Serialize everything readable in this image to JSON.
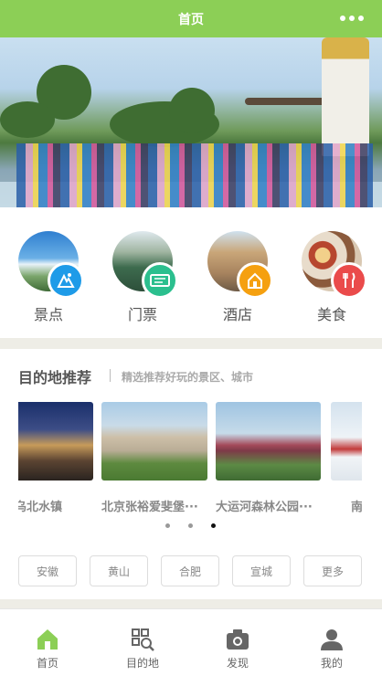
{
  "header": {
    "title": "首页",
    "more_icon": "more-dots-icon"
  },
  "categories": [
    {
      "label": "景点",
      "icon": "scenic-spot-icon",
      "badge_color": "#1e9be8"
    },
    {
      "label": "门票",
      "icon": "ticket-icon",
      "badge_color": "#2bbf8e"
    },
    {
      "label": "酒店",
      "icon": "hotel-icon",
      "badge_color": "#f5a010"
    },
    {
      "label": "美食",
      "icon": "food-icon",
      "badge_color": "#ea4b4b"
    }
  ],
  "recommend": {
    "title": "目的地推荐",
    "subtitle": "精选推荐好玩的景区、城市",
    "cards": [
      {
        "name": "乌北水镇"
      },
      {
        "name": "北京张裕爱斐堡···"
      },
      {
        "name": "大运河森林公园···"
      },
      {
        "name": "南"
      }
    ],
    "pager": {
      "count": 3,
      "active": 3
    },
    "tags": [
      "安徽",
      "黄山",
      "合肥",
      "宣城",
      "更多"
    ]
  },
  "tabbar": {
    "items": [
      {
        "label": "首页",
        "icon": "home-icon",
        "active": true
      },
      {
        "label": "目的地",
        "icon": "destination-search-icon",
        "active": false
      },
      {
        "label": "发现",
        "icon": "camera-icon",
        "active": false
      },
      {
        "label": "我的",
        "icon": "user-icon",
        "active": false
      }
    ]
  },
  "colors": {
    "brand": "#8ccf56",
    "section_gap": "#eeede6"
  }
}
